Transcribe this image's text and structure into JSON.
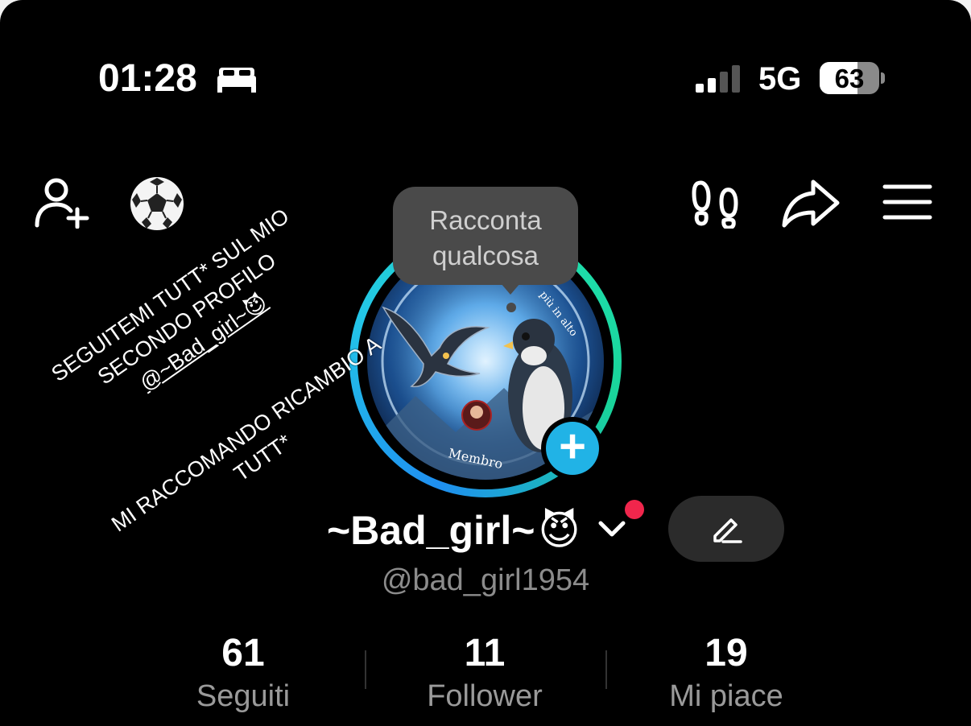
{
  "status_bar": {
    "time": "01:28",
    "focus_icon": "bed-icon",
    "network": "5G",
    "battery": "63",
    "battery_level": 0.63
  },
  "top_bar": {
    "icons": [
      "add-user-icon",
      "soccer-ball-icon",
      "footprints-icon",
      "share-icon",
      "menu-icon"
    ]
  },
  "tooltip": {
    "line1": "Racconta",
    "line2": "qualcosa"
  },
  "avatar": {
    "text_top": "più in alto",
    "text_bottom": "Membro"
  },
  "overlay": {
    "line1": "SEGUITEMI TUTT* SUL MIO",
    "line2": "SECONDO PROFILO",
    "line3": "@~Bad_girl~😈",
    "line4": "MI RACCOMANDO RICAMBIO A",
    "line5": "TUTT*"
  },
  "profile": {
    "name": "~Bad_girl~",
    "name_emoji": "😈",
    "handle": "@bad_girl1954"
  },
  "stats": [
    {
      "value": "61",
      "label": "Seguiti"
    },
    {
      "value": "11",
      "label": "Follower"
    },
    {
      "value": "19",
      "label": "Mi piace"
    }
  ],
  "colors": {
    "background": "#000000",
    "ring_start": "#1f8ff0",
    "ring_end": "#19d49a",
    "add_story": "#21b3e6",
    "notification_dot": "#f0264c"
  }
}
